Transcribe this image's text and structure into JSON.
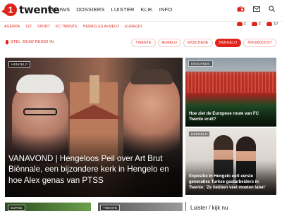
{
  "header": {
    "logo_mark": "1",
    "logo_text": "twente",
    "nav": [
      "NIEUWS",
      "DOSSIERS",
      "LUISTER",
      "KLIK",
      "INFO"
    ]
  },
  "subnav": [
    "AGENDA",
    "112",
    "SPORT",
    "FC TWENTE",
    "HERACLES ALMELO",
    "EUREGIO"
  ],
  "weather": [
    {
      "value": "2"
    },
    {
      "value": "2"
    },
    {
      "value": "10"
    }
  ],
  "region": {
    "label": "STEL JOUW REGIO IN",
    "chips": [
      "TWENTE",
      "ALMELO",
      "ENSCHEDE",
      "HENGELO",
      "NOORDOOST"
    ],
    "active": "HENGELO"
  },
  "hero": {
    "tag": "HENGELO",
    "title": "VANAVOND | Hengeloos Peil over Art Brut Biënnale, een bijzondere kerk in Hengelo en hoe Alex genas van PTSS"
  },
  "cards": [
    {
      "tag": "ENSCHEDE",
      "title": "Hoe ziet de Europese route van FC Twente eruit?"
    },
    {
      "tag": "HENGELO",
      "title": "Expositie in Hengelo eert eerste generaties Turkse gastarbeiders in Twente: 'Ze hebben veel moeten laten'"
    },
    {
      "tag": "BORNE"
    },
    {
      "tag": "TWENTE"
    }
  ],
  "luister": "Luister / kijk nu",
  "colors": {
    "brand": "#e2231a",
    "text": "#1c1c1c"
  }
}
